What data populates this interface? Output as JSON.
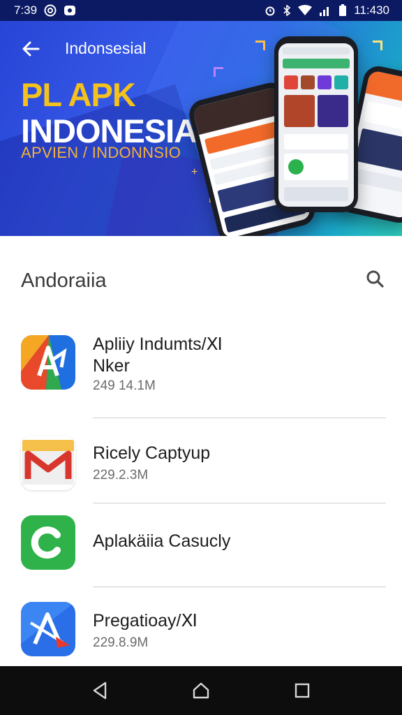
{
  "status_bar": {
    "time": "7:39",
    "clock_right": "11:430",
    "left_icons": [
      "copyright-circle-icon",
      "notification-app-icon"
    ],
    "right_icons": [
      "alarm-icon",
      "bluetooth-icon",
      "wifi-icon",
      "signal-icon",
      "battery-icon"
    ]
  },
  "header": {
    "title": "Indonsesial"
  },
  "hero": {
    "headline_line1": "PL APK",
    "headline_line2": "INDONESIA",
    "subtitle": "APVIEN / INDONNSIO",
    "colors": {
      "headline_accent": "#f4c21d",
      "subtitle": "#f4b23a"
    }
  },
  "section": {
    "title": "Andoraiia"
  },
  "apps": [
    {
      "name_line1": "Apliiy Indumts/Ⅺ",
      "name_line2": "Nker",
      "meta": "249 14.1M",
      "icon": "multicolor-a-icon"
    },
    {
      "name_line1": "Ricely Captyup",
      "name_line2": "",
      "meta": "229.2.3M",
      "icon": "gmail-envelope-icon"
    },
    {
      "name_line1": "Aplakäiia Casucly",
      "name_line2": "",
      "meta": "",
      "icon": "green-c-icon"
    },
    {
      "name_line1": "Pregatioay/Ⅺ",
      "name_line2": "",
      "meta": "229.8.9M",
      "icon": "blue-a-arrow-icon"
    }
  ],
  "nav": {
    "icons": [
      "back-triangle-icon",
      "home-icon",
      "recents-square-icon"
    ]
  }
}
